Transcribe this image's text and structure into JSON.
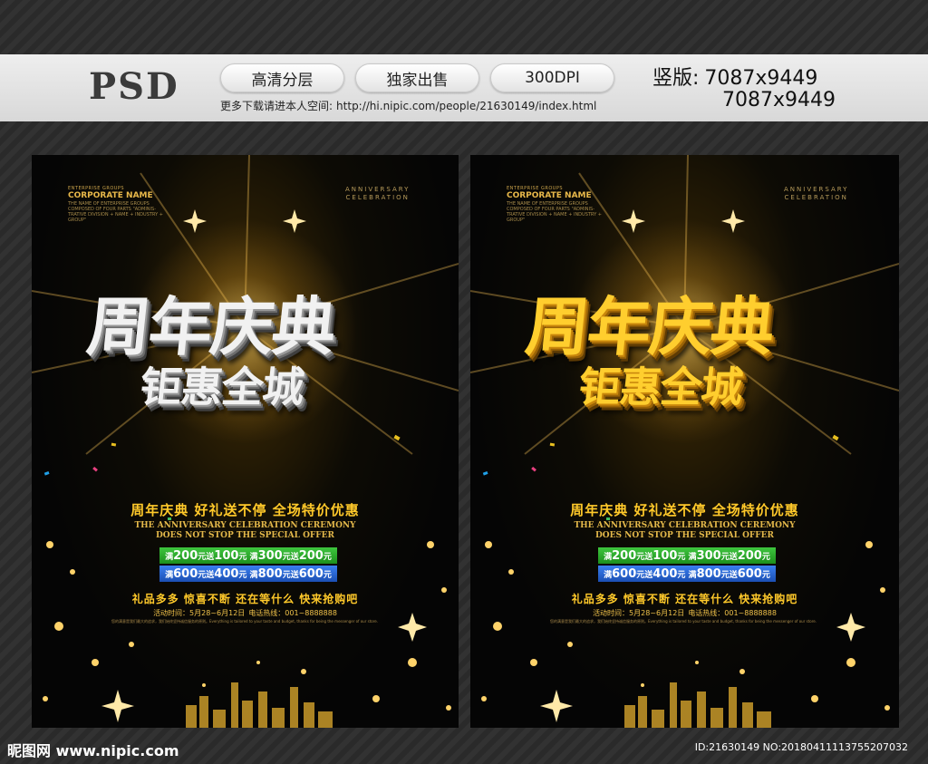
{
  "header": {
    "psd_label": "PSD",
    "pills": [
      "高清分层",
      "独家出售",
      "300DPI"
    ],
    "space_text": "更多下载请进本人空间:",
    "space_url": "http://hi.nipic.com/people/21630149/index.html",
    "version_label": "竖版:",
    "size_1": "7087x9449",
    "size_2": "7087x9449"
  },
  "poster": {
    "corp_small": "ENTERPRISE GROUPS",
    "corp_name": "CORPORATE NAME",
    "corp_desc": "THE NAME OF ENTERPRISE GROUPS COMPOSED OF FOUR PARTS \"ADMINIS- TRATIVE DIVISION + NAME + INDUSTRY + GROUP\"",
    "anniv_1": "ANNIVERSARY",
    "anniv_2": "CELEBRATION",
    "title_1": "周年庆典",
    "title_2": "钜惠全城",
    "tagline": "周年庆典 好礼送不停 全场特价优惠",
    "en_1": "THE ANNIVERSARY CELEBRATION CEREMONY",
    "en_2": "DOES NOT STOP THE SPECIAL OFFER",
    "offer_1": {
      "a": "满",
      "b": "200",
      "c": "元送",
      "d": "100",
      "e": "元 满",
      "f": "300",
      "g": "元送",
      "h": "200",
      "i": "元"
    },
    "offer_2": {
      "a": "满",
      "b": "600",
      "c": "元送",
      "d": "400",
      "e": "元 满",
      "f": "800",
      "g": "元送",
      "h": "600",
      "i": "元"
    },
    "gifts": "礼品多多 惊喜不断 还在等什么 快来抢购吧",
    "event_time": "活动时间：5月28~6月12日",
    "event_phone": "电话热线：001~8888888",
    "fine_print": "您的满意是我们最大的追求，我们始终坚持诚信服务的原则。Everything is tailored to your taste and budget, thanks for being the messenger of our store."
  },
  "footer": {
    "logo": "昵图网 www.nipic.com",
    "id_text": "ID:21630149 NO:20180411113755207032"
  },
  "colors": {
    "accent_gold": "#ffc92a",
    "green_bar": "#2aa82a",
    "blue_bar": "#2a66d6"
  }
}
